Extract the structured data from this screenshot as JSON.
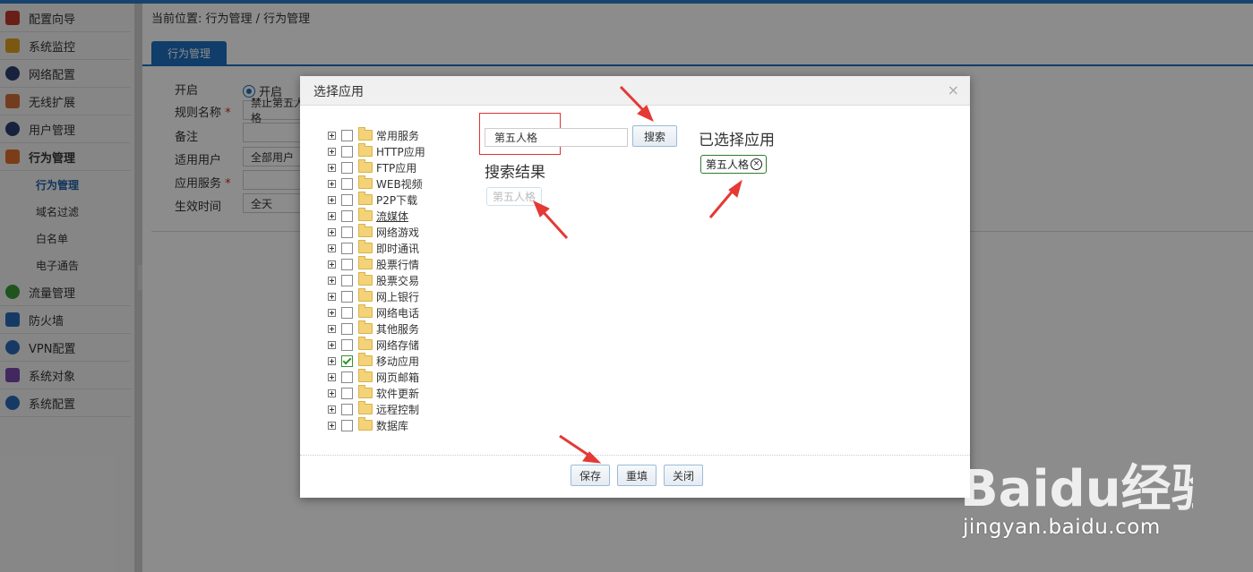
{
  "sidebar": {
    "items": [
      {
        "label": "配置向导",
        "icon": "flag-icon",
        "color": "#c0392b"
      },
      {
        "label": "系统监控",
        "icon": "monitor-icon",
        "color": "#e0a020"
      },
      {
        "label": "网络配置",
        "icon": "globe-icon",
        "color": "#2c3e70"
      },
      {
        "label": "无线扩展",
        "icon": "router-icon",
        "color": "#d0703a"
      },
      {
        "label": "用户管理",
        "icon": "users-icon",
        "color": "#2c3e70"
      },
      {
        "label": "行为管理",
        "icon": "hand-icon",
        "color": "#e0702a"
      }
    ],
    "subitems": [
      {
        "label": "行为管理"
      },
      {
        "label": "域名过滤"
      },
      {
        "label": "白名单"
      },
      {
        "label": "电子通告"
      }
    ],
    "items2": [
      {
        "label": "流量管理",
        "icon": "traffic-icon",
        "color": "#3a9a3a"
      },
      {
        "label": "防火墙",
        "icon": "shield-icon",
        "color": "#2a6ab8"
      },
      {
        "label": "VPN配置",
        "icon": "vpn-icon",
        "color": "#2a6ab8"
      },
      {
        "label": "系统对象",
        "icon": "cube-icon",
        "color": "#7a4ab0"
      },
      {
        "label": "系统配置",
        "icon": "gear-icon",
        "color": "#2a6ab8"
      }
    ]
  },
  "main": {
    "breadcrumb": "当前位置: 行为管理 / 行为管理",
    "tab": "行为管理",
    "form": {
      "enable_label": "开启",
      "enable_value": "开启",
      "rule_name_label": "规则名称",
      "rule_name_value": "禁止第五人格",
      "remark_label": "备注",
      "user_label": "适用用户",
      "user_value": "全部用户",
      "service_label": "应用服务",
      "time_label": "生效时间",
      "time_value": "全天",
      "required_mark": "*"
    }
  },
  "dialog": {
    "title": "选择应用",
    "close": "×",
    "tree": [
      {
        "label": "常用服务",
        "checked": false
      },
      {
        "label": "HTTP应用",
        "checked": false
      },
      {
        "label": "FTP应用",
        "checked": false
      },
      {
        "label": "WEB视频",
        "checked": false
      },
      {
        "label": "P2P下载",
        "checked": false
      },
      {
        "label": "流媒体",
        "checked": false
      },
      {
        "label": "网络游戏",
        "checked": false
      },
      {
        "label": "即时通讯",
        "checked": false
      },
      {
        "label": "股票行情",
        "checked": false
      },
      {
        "label": "股票交易",
        "checked": false
      },
      {
        "label": "网上银行",
        "checked": false
      },
      {
        "label": "网络电话",
        "checked": false
      },
      {
        "label": "其他服务",
        "checked": false
      },
      {
        "label": "网络存储",
        "checked": false
      },
      {
        "label": "移动应用",
        "checked": true
      },
      {
        "label": "网页邮箱",
        "checked": false
      },
      {
        "label": "软件更新",
        "checked": false
      },
      {
        "label": "远程控制",
        "checked": false
      },
      {
        "label": "数据库",
        "checked": false
      }
    ],
    "search_value": "第五人格",
    "search_button": "搜索",
    "result_title": "搜索结果",
    "result_item": "第五人格",
    "selected_title": "已选择应用",
    "selected_item": "第五人格",
    "selected_remove": "×",
    "save_button": "保存",
    "reset_button": "重填",
    "close_button": "关闭"
  },
  "watermark": {
    "text": "jingyan.baidu.com",
    "logo_text": "Baidu经验"
  },
  "colors": {
    "accent": "#1e6fbf",
    "annotation_arrow": "#e53935",
    "selected_chip_border": "#2e7d2e"
  }
}
